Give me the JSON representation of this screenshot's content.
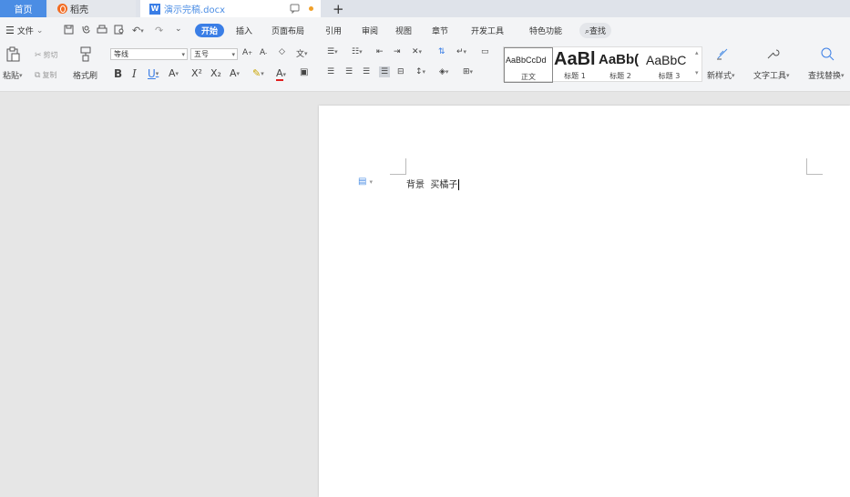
{
  "tabs": {
    "home": "首页",
    "daoke": "稻壳",
    "doc": "演示完稿.docx",
    "new_tab": "+"
  },
  "menu": {
    "file": "文件",
    "items": [
      "开始",
      "插入",
      "页面布局",
      "引用",
      "审阅",
      "视图",
      "章节",
      "开发工具",
      "特色功能"
    ],
    "search": "查找"
  },
  "ribbon": {
    "paste": "粘贴",
    "cut": "剪切",
    "copy": "复制",
    "format_painter": "格式刷",
    "font_name": "等线",
    "font_size": "五号",
    "bold": "B",
    "italic": "I",
    "underline": "U",
    "styles": [
      {
        "sample": "AaBbCcDd",
        "name": "正文"
      },
      {
        "sample": "AaBl",
        "name": "标题 1"
      },
      {
        "sample": "AaBb(",
        "name": "标题 2"
      },
      {
        "sample": "AaBbC",
        "name": "标题 3"
      }
    ],
    "new_style": "新样式",
    "text_tools": "文字工具",
    "find_replace": "查找替换"
  },
  "document": {
    "text": "背景  买橘子"
  },
  "colors": {
    "accent": "#3a7ee6",
    "home_tab": "#4b8de4",
    "daoke": "#f26b21"
  }
}
